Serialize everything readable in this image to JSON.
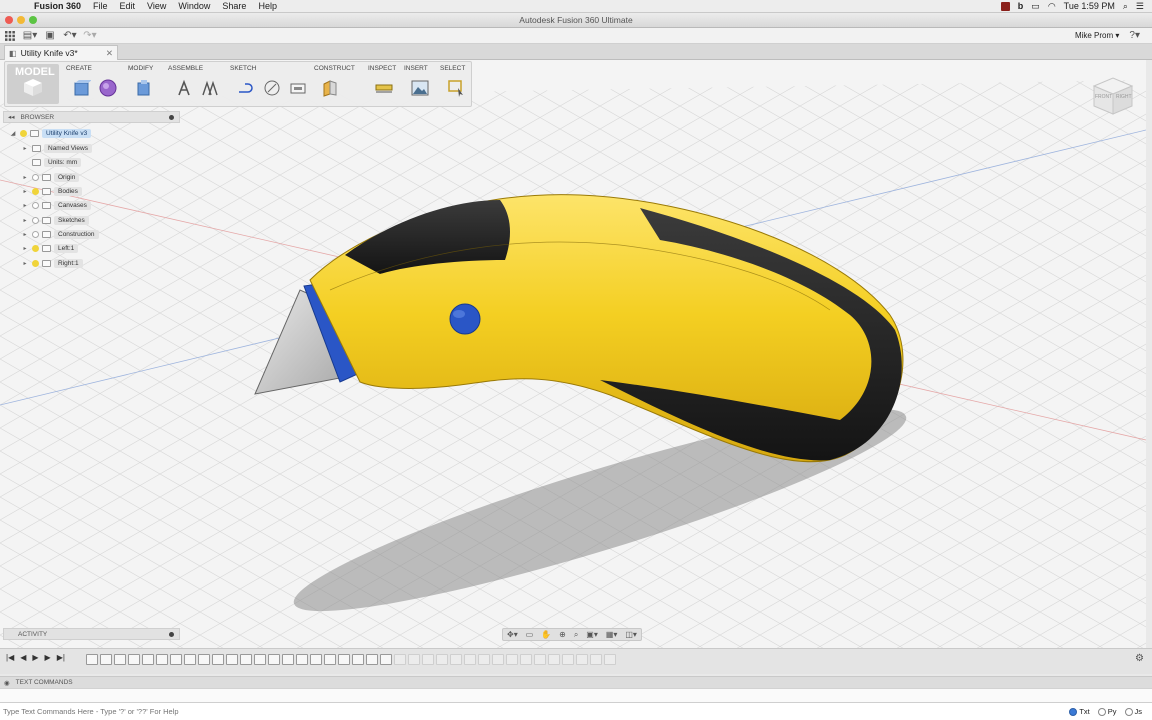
{
  "mac_menu": {
    "app": "Fusion 360",
    "items": [
      "File",
      "Edit",
      "View",
      "Window",
      "Share",
      "Help"
    ],
    "clock": "Tue 1:59 PM"
  },
  "window": {
    "title": "Autodesk Fusion 360 Ultimate"
  },
  "appbar": {
    "user": "Mike Prom ▾",
    "help": "?▾"
  },
  "doc_tab": {
    "label": "Utility Knife v3*"
  },
  "ribbon": {
    "workspace": "MODEL",
    "groups": [
      "CREATE",
      "MODIFY",
      "ASSEMBLE",
      "SKETCH",
      "CONSTRUCT",
      "INSPECT",
      "INSERT",
      "SELECT"
    ]
  },
  "browser": {
    "header": "BROWSER",
    "root": "Utility Knife v3",
    "nodes": [
      "Named Views",
      "Units: mm",
      "Origin",
      "Bodies",
      "Canvases",
      "Sketches",
      "Construction",
      "Left:1",
      "Right:1"
    ]
  },
  "activity": {
    "header": "ACTIVITY"
  },
  "viewcube": {
    "front": "FRONT",
    "right": "RIGHT"
  },
  "text_commands": {
    "header": "TEXT COMMANDS",
    "placeholder": "Type Text Commands Here - Type '?' or '??' For Help",
    "modes": [
      "Txt",
      "Py",
      "Js"
    ]
  },
  "colors": {
    "body_yellow": "#f2c91e",
    "grip_black": "#1e1e1e",
    "blade_blue": "#2a56c6",
    "selection_blue": "#c9dff5"
  }
}
